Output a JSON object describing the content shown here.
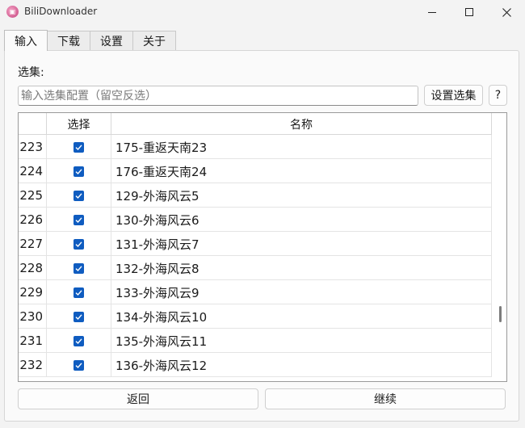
{
  "window": {
    "title": "BiliDownloader",
    "icon_text": "Bili",
    "controls": [
      "minimize-icon",
      "maximize-icon",
      "close-icon"
    ]
  },
  "tabs": [
    {
      "label": "输入",
      "active": true
    },
    {
      "label": "下载",
      "active": false
    },
    {
      "label": "设置",
      "active": false
    },
    {
      "label": "关于",
      "active": false
    }
  ],
  "episode_select": {
    "label": "选集:",
    "placeholder": "输入选集配置（留空反选）",
    "value": "",
    "set_button": "设置选集",
    "help_button": "?"
  },
  "table": {
    "columns": [
      "",
      "选择",
      "名称"
    ],
    "rows": [
      {
        "index": "223",
        "checked": true,
        "name": "175-重返天南23"
      },
      {
        "index": "224",
        "checked": true,
        "name": "176-重返天南24"
      },
      {
        "index": "225",
        "checked": true,
        "name": "129-外海风云5"
      },
      {
        "index": "226",
        "checked": true,
        "name": "130-外海风云6"
      },
      {
        "index": "227",
        "checked": true,
        "name": "131-外海风云7"
      },
      {
        "index": "228",
        "checked": true,
        "name": "132-外海风云8"
      },
      {
        "index": "229",
        "checked": true,
        "name": "133-外海风云9"
      },
      {
        "index": "230",
        "checked": true,
        "name": "134-外海风云10"
      },
      {
        "index": "231",
        "checked": true,
        "name": "135-外海风云11"
      },
      {
        "index": "232",
        "checked": true,
        "name": "136-外海风云12"
      }
    ]
  },
  "actions": {
    "back": "返回",
    "continue": "继续"
  },
  "colors": {
    "accent": "#0f5cc0",
    "background": "#f3f3f3"
  }
}
